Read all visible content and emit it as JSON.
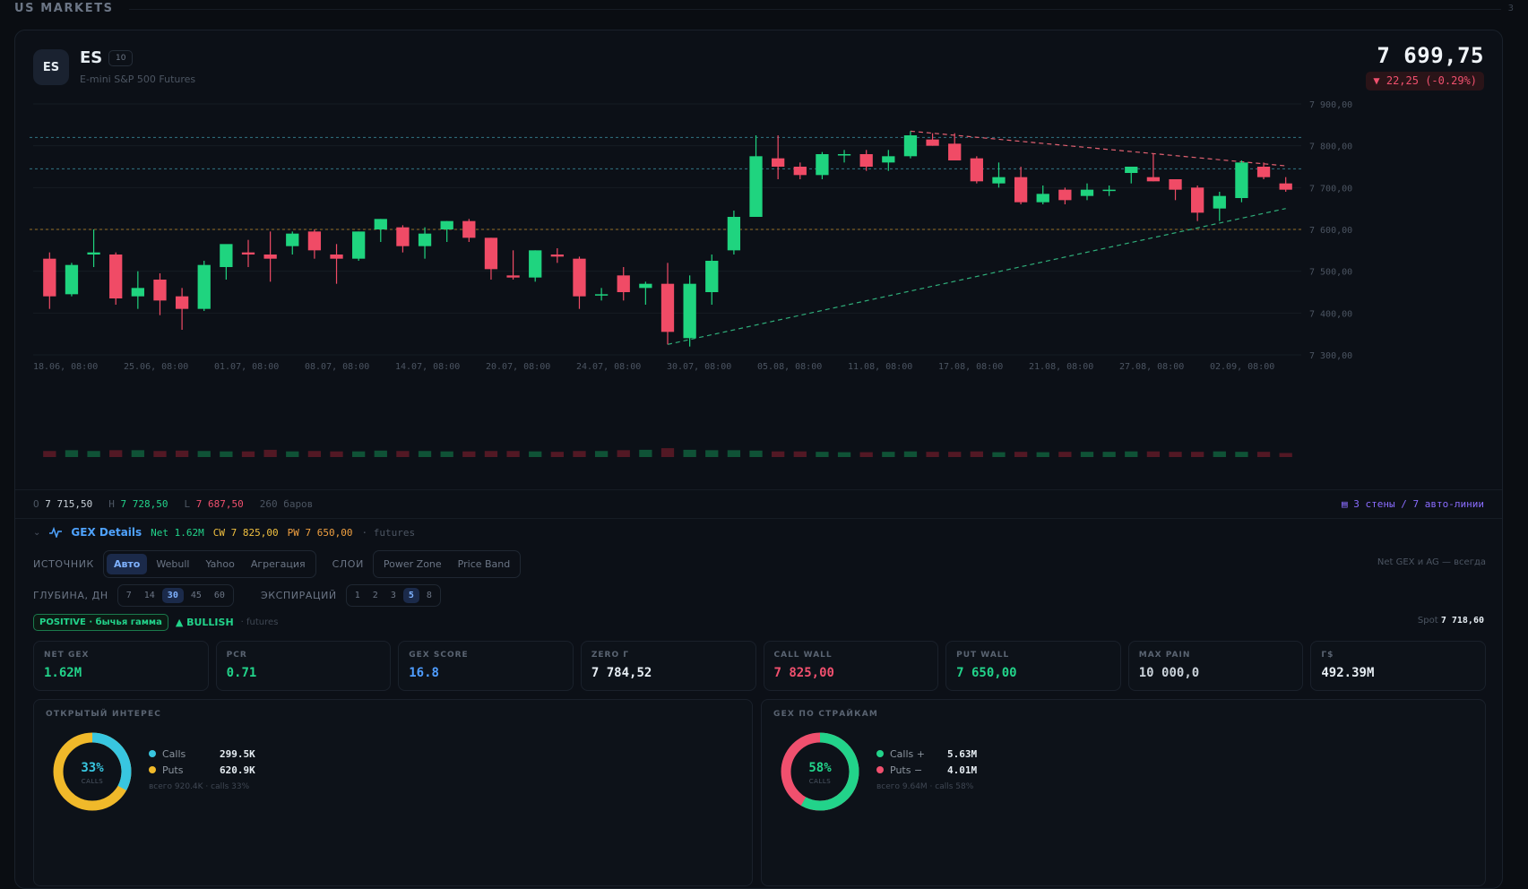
{
  "header": {
    "title": "US MARKETS",
    "corner": "3"
  },
  "instrument": {
    "logo": "ES",
    "ticker": "ES",
    "badge": "10",
    "name": "E-mini S&P 500 Futures",
    "price": "7 699,75",
    "change": "▼ 22,25 (-0.29%)"
  },
  "chart_data": {
    "type": "candlestick",
    "y_tick_labels": [
      "7 900,00",
      "7 800,00",
      "7 700,00",
      "7 600,00",
      "7 500,00",
      "7 400,00",
      "7 300,00"
    ],
    "ylim": [
      7300,
      7900
    ],
    "x_tick_labels": [
      "18.06, 08:00",
      "25.06, 08:00",
      "01.07, 08:00",
      "08.07, 08:00",
      "14.07, 08:00",
      "20.07, 08:00",
      "24.07, 08:00",
      "30.07, 08:00",
      "05.08, 08:00",
      "11.08, 08:00",
      "17.08, 08:00",
      "21.08, 08:00",
      "27.08, 08:00",
      "02.09, 08:00"
    ],
    "candles": [
      [
        7530,
        7545,
        7410,
        7440
      ],
      [
        7445,
        7520,
        7440,
        7515
      ],
      [
        7540,
        7600,
        7510,
        7545
      ],
      [
        7540,
        7545,
        7420,
        7435
      ],
      [
        7440,
        7500,
        7410,
        7460
      ],
      [
        7480,
        7495,
        7395,
        7430
      ],
      [
        7440,
        7460,
        7360,
        7410
      ],
      [
        7410,
        7525,
        7405,
        7515
      ],
      [
        7510,
        7560,
        7480,
        7565
      ],
      [
        7545,
        7575,
        7510,
        7540
      ],
      [
        7540,
        7595,
        7475,
        7530
      ],
      [
        7560,
        7595,
        7540,
        7590
      ],
      [
        7595,
        7600,
        7530,
        7550
      ],
      [
        7540,
        7565,
        7470,
        7530
      ],
      [
        7530,
        7595,
        7525,
        7595
      ],
      [
        7600,
        7625,
        7570,
        7625
      ],
      [
        7605,
        7610,
        7545,
        7560
      ],
      [
        7560,
        7605,
        7530,
        7590
      ],
      [
        7600,
        7620,
        7570,
        7620
      ],
      [
        7620,
        7625,
        7570,
        7580
      ],
      [
        7580,
        7580,
        7480,
        7505
      ],
      [
        7490,
        7550,
        7480,
        7485
      ],
      [
        7485,
        7550,
        7475,
        7550
      ],
      [
        7540,
        7555,
        7520,
        7535
      ],
      [
        7530,
        7535,
        7410,
        7440
      ],
      [
        7445,
        7460,
        7430,
        7445
      ],
      [
        7490,
        7510,
        7430,
        7450
      ],
      [
        7460,
        7475,
        7420,
        7470
      ],
      [
        7470,
        7520,
        7325,
        7355
      ],
      [
        7340,
        7490,
        7320,
        7470
      ],
      [
        7450,
        7540,
        7420,
        7525
      ],
      [
        7550,
        7645,
        7540,
        7630
      ],
      [
        7630,
        7825,
        7630,
        7775
      ],
      [
        7770,
        7825,
        7720,
        7750
      ],
      [
        7750,
        7760,
        7720,
        7730
      ],
      [
        7730,
        7785,
        7720,
        7780
      ],
      [
        7780,
        7790,
        7760,
        7780
      ],
      [
        7780,
        7790,
        7740,
        7750
      ],
      [
        7760,
        7790,
        7740,
        7775
      ],
      [
        7775,
        7835,
        7770,
        7825
      ],
      [
        7815,
        7830,
        7800,
        7800
      ],
      [
        7805,
        7830,
        7765,
        7765
      ],
      [
        7770,
        7775,
        7710,
        7715
      ],
      [
        7710,
        7760,
        7700,
        7725
      ],
      [
        7725,
        7750,
        7660,
        7665
      ],
      [
        7665,
        7705,
        7660,
        7685
      ],
      [
        7695,
        7700,
        7660,
        7670
      ],
      [
        7680,
        7710,
        7670,
        7695
      ],
      [
        7695,
        7705,
        7680,
        7695
      ],
      [
        7735,
        7750,
        7710,
        7750
      ],
      [
        7725,
        7780,
        7715,
        7715
      ],
      [
        7720,
        7720,
        7670,
        7695
      ],
      [
        7700,
        7705,
        7620,
        7640
      ],
      [
        7650,
        7690,
        7620,
        7680
      ],
      [
        7675,
        7765,
        7665,
        7760
      ],
      [
        7750,
        7760,
        7720,
        7725
      ],
      [
        7710,
        7725,
        7690,
        7695
      ]
    ],
    "levels": [
      7820,
      7745,
      7600
    ],
    "volume": [
      15,
      17,
      15,
      17,
      17,
      15,
      16,
      15,
      14,
      14,
      18,
      14,
      15,
      14,
      14,
      16,
      15,
      15,
      14,
      14,
      15,
      15,
      14,
      13,
      15,
      15,
      17,
      18,
      22,
      18,
      17,
      17,
      16,
      14,
      14,
      13,
      12,
      12,
      13,
      14,
      13,
      13,
      14,
      12,
      13,
      12,
      13,
      13,
      13,
      14,
      14,
      13,
      13,
      14,
      13,
      13,
      10
    ]
  },
  "stats_bar": {
    "o_label": "O",
    "o": "7 715,50",
    "h_label": "H",
    "h": "7 728,50",
    "l_label": "L",
    "l": "7 687,50",
    "bars": "260 баров",
    "walls": "▤ 3 стены / 7 авто-линии"
  },
  "gex": {
    "title": "GEX Details",
    "net": "Net 1.62M",
    "cw": "CW 7 825,00",
    "pw": "PW 7 650,00",
    "tag": "· futures",
    "source_label": "ИСТОЧНИК",
    "sources": [
      "Авто",
      "Webull",
      "Yahoo",
      "Агрегация"
    ],
    "layers_label": "СЛОИ",
    "layers": [
      "Power Zone",
      "Price Band"
    ],
    "right_note": "Net GEX и AG — всегда",
    "depth_label": "ГЛУБИНА, ДН",
    "depths": [
      "7",
      "14",
      "30",
      "45",
      "60"
    ],
    "exp_label": "ЭКСПИРАЦИЙ",
    "exps": [
      "1",
      "2",
      "3",
      "5",
      "8"
    ],
    "positive": "POSITIVE · бычья гамма",
    "bullish": "▲ BULLISH",
    "futures": "· futures",
    "spot_label": "Spot",
    "spot": "7 718,60"
  },
  "metrics": [
    {
      "key": "NET GEX",
      "value": "1.62M",
      "color": "#22d38a"
    },
    {
      "key": "PCR",
      "value": "0.71",
      "color": "#22d38a"
    },
    {
      "key": "GEX SCORE",
      "value": "16.8",
      "color": "#4f9dff"
    },
    {
      "key": "ZERO Γ",
      "value": "7 784,52",
      "color": "#e6edf3"
    },
    {
      "key": "CALL WALL",
      "value": "7 825,00",
      "color": "#f0506e"
    },
    {
      "key": "PUT WALL",
      "value": "7 650,00",
      "color": "#22d38a"
    },
    {
      "key": "MAX PAIN",
      "value": "10 000,0",
      "color": "#c9d1d9"
    },
    {
      "key": "Γ$",
      "value": "492.39M",
      "color": "#e6edf3"
    }
  ],
  "oi": {
    "title": "ОТКРЫТЫЙ ИНТЕРЕС",
    "pct": "33%",
    "sub": "CALLS",
    "calls_label": "Calls",
    "calls": "299.5K",
    "puts_label": "Puts",
    "puts": "620.9K",
    "note": "всего 920.4K · calls 33%",
    "fraction": 0.33
  },
  "strikes": {
    "title": "GEX ПО СТРАЙКАМ",
    "pct": "58%",
    "sub": "CALLS",
    "calls_label": "Calls +",
    "calls": "5.63M",
    "puts_label": "Puts −",
    "puts": "4.01M",
    "note": "всего 9.64M · calls 58%",
    "fraction": 0.58
  }
}
